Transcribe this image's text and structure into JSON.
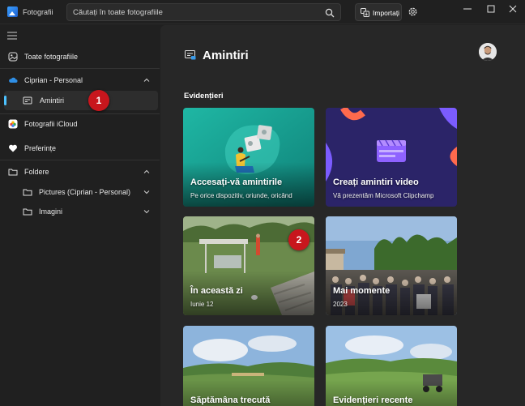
{
  "titlebar": {
    "app_name": "Fotografii",
    "search_placeholder": "Căutați în toate fotografiile",
    "import_label": "Importați"
  },
  "sidebar": {
    "all_photos": "Toate fotografiile",
    "account": "Ciprian - Personal",
    "memories": "Amintiri",
    "icloud": "Fotografii iCloud",
    "favorites": "Preferințe",
    "folders": "Foldere",
    "folder_items": [
      "Pictures (Ciprian - Personal)",
      "Imagini"
    ]
  },
  "main": {
    "title": "Amintiri",
    "section": "Evidențieri",
    "cards": [
      {
        "title": "Accesați-vă amintirile",
        "subtitle": "Pe orice dispozitiv, oriunde, oricând"
      },
      {
        "title": "Creați amintiri video",
        "subtitle": "Vă prezentăm Microsoft Clipchamp"
      },
      {
        "title": "În această zi",
        "subtitle": "Iunie 12"
      },
      {
        "title": "Mai momente",
        "subtitle": "2023"
      },
      {
        "title": "Săptămâna trecută",
        "subtitle": ""
      },
      {
        "title": "Evidențieri recente",
        "subtitle": ""
      }
    ]
  },
  "badges": [
    "1",
    "2"
  ],
  "icons": {
    "app": "photos-app-icon",
    "search": "search-icon",
    "import": "import-icon",
    "settings": "gear-icon",
    "all_photos": "photos-icon",
    "account": "cloud-icon",
    "memories": "memories-icon",
    "icloud": "icloud-icon",
    "favorites": "heart-icon",
    "folders": "folder-icon"
  },
  "colors": {
    "accent": "#4cc2ff",
    "badge": "#c8161d",
    "card_teal": "#1aa89a",
    "card_navy": "#2b2468"
  }
}
